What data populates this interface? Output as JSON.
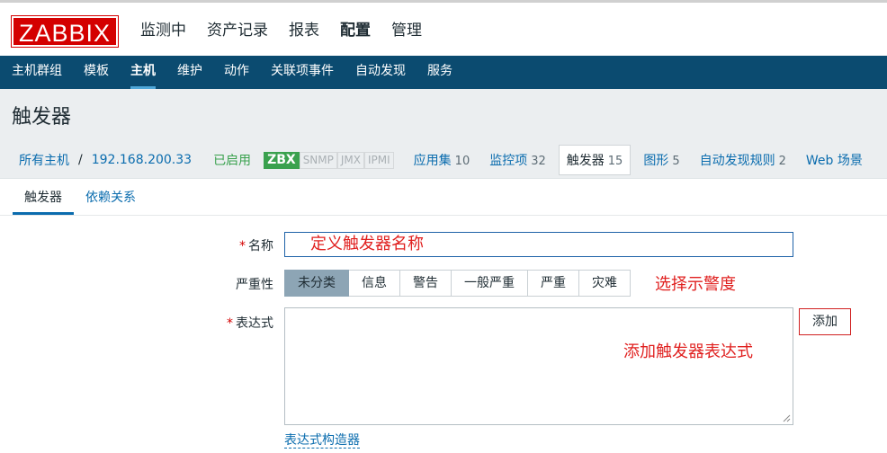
{
  "header": {
    "logo": "ZABBIX",
    "menu": [
      "监测中",
      "资产记录",
      "报表",
      "配置",
      "管理"
    ],
    "menu_active": 3
  },
  "submenu": {
    "items": [
      "主机群组",
      "模板",
      "主机",
      "维护",
      "动作",
      "关联项事件",
      "自动发现",
      "服务"
    ],
    "active": 2
  },
  "page": {
    "title": "触发器"
  },
  "breadcrumb": {
    "all_hosts": "所有主机",
    "separator": "/",
    "host": "192.168.200.33",
    "status": "已启用",
    "badges": [
      "ZBX",
      "SNMP",
      "JMX",
      "IPMI"
    ],
    "items": [
      {
        "label": "应用集",
        "count": "10"
      },
      {
        "label": "监控项",
        "count": "32"
      },
      {
        "label": "触发器",
        "count": "15"
      },
      {
        "label": "图形",
        "count": "5"
      },
      {
        "label": "自动发现规则",
        "count": "2"
      },
      {
        "label": "Web 场景",
        "count": ""
      }
    ]
  },
  "tabs": [
    "触发器",
    "依赖关系"
  ],
  "form": {
    "name_label": "名称",
    "severity_label": "严重性",
    "severity_options": [
      "未分类",
      "信息",
      "警告",
      "一般严重",
      "严重",
      "灾难"
    ],
    "severity_selected": "未分类",
    "expression_label": "表达式",
    "required_mark": "*",
    "add_button": "添加",
    "builder_link": "表达式构造器"
  },
  "annotations": {
    "name_note": "定义触发器名称",
    "severity_note": "选择示警度",
    "expression_note": "添加触发器表达式"
  },
  "colors": {
    "logo_red": "#d40000",
    "nav_blue": "#0b4b70",
    "link_blue": "#0a6cae",
    "enabled_green": "#3aa14e",
    "annotation_red": "#e0201f"
  }
}
